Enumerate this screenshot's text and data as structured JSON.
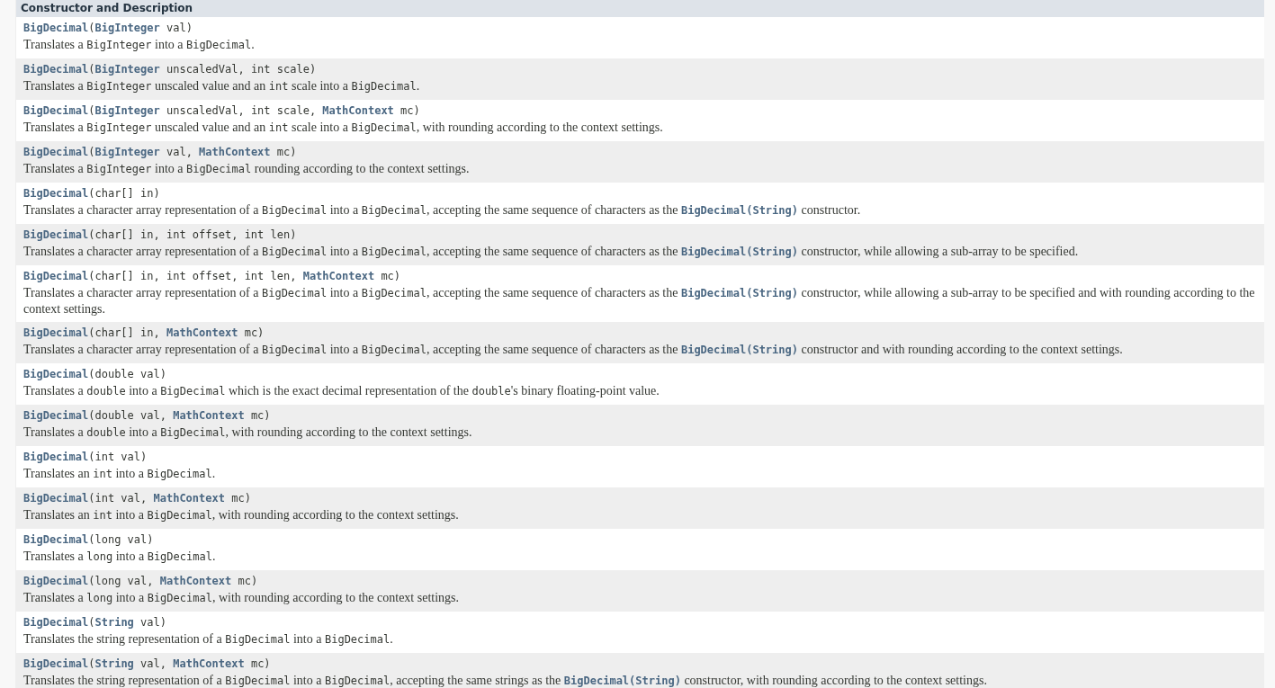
{
  "table": {
    "header": "Constructor and Description",
    "rows": [
      {
        "signature": [
          {
            "kind": "link",
            "text": "BigDecimal"
          },
          {
            "kind": "code",
            "text": "("
          },
          {
            "kind": "link",
            "text": "BigInteger"
          },
          {
            "kind": "code",
            "text": " val)"
          }
        ],
        "description": [
          {
            "kind": "text",
            "text": "Translates a "
          },
          {
            "kind": "code",
            "text": "BigInteger"
          },
          {
            "kind": "text",
            "text": " into a "
          },
          {
            "kind": "code",
            "text": "BigDecimal"
          },
          {
            "kind": "text",
            "text": "."
          }
        ]
      },
      {
        "signature": [
          {
            "kind": "link",
            "text": "BigDecimal"
          },
          {
            "kind": "code",
            "text": "("
          },
          {
            "kind": "link",
            "text": "BigInteger"
          },
          {
            "kind": "code",
            "text": " unscaledVal, int scale)"
          }
        ],
        "description": [
          {
            "kind": "text",
            "text": "Translates a "
          },
          {
            "kind": "code",
            "text": "BigInteger"
          },
          {
            "kind": "text",
            "text": " unscaled value and an "
          },
          {
            "kind": "code",
            "text": "int"
          },
          {
            "kind": "text",
            "text": " scale into a "
          },
          {
            "kind": "code",
            "text": "BigDecimal"
          },
          {
            "kind": "text",
            "text": "."
          }
        ]
      },
      {
        "signature": [
          {
            "kind": "link",
            "text": "BigDecimal"
          },
          {
            "kind": "code",
            "text": "("
          },
          {
            "kind": "link",
            "text": "BigInteger"
          },
          {
            "kind": "code",
            "text": " unscaledVal, int scale, "
          },
          {
            "kind": "link",
            "text": "MathContext"
          },
          {
            "kind": "code",
            "text": " mc)"
          }
        ],
        "description": [
          {
            "kind": "text",
            "text": "Translates a "
          },
          {
            "kind": "code",
            "text": "BigInteger"
          },
          {
            "kind": "text",
            "text": " unscaled value and an "
          },
          {
            "kind": "code",
            "text": "int"
          },
          {
            "kind": "text",
            "text": " scale into a "
          },
          {
            "kind": "code",
            "text": "BigDecimal"
          },
          {
            "kind": "text",
            "text": ", with rounding according to the context settings."
          }
        ]
      },
      {
        "signature": [
          {
            "kind": "link",
            "text": "BigDecimal"
          },
          {
            "kind": "code",
            "text": "("
          },
          {
            "kind": "link",
            "text": "BigInteger"
          },
          {
            "kind": "code",
            "text": " val, "
          },
          {
            "kind": "link",
            "text": "MathContext"
          },
          {
            "kind": "code",
            "text": " mc)"
          }
        ],
        "description": [
          {
            "kind": "text",
            "text": "Translates a "
          },
          {
            "kind": "code",
            "text": "BigInteger"
          },
          {
            "kind": "text",
            "text": " into a "
          },
          {
            "kind": "code",
            "text": "BigDecimal"
          },
          {
            "kind": "text",
            "text": " rounding according to the context settings."
          }
        ]
      },
      {
        "signature": [
          {
            "kind": "link",
            "text": "BigDecimal"
          },
          {
            "kind": "code",
            "text": "(char[] in)"
          }
        ],
        "description": [
          {
            "kind": "text",
            "text": "Translates a character array representation of a "
          },
          {
            "kind": "code",
            "text": "BigDecimal"
          },
          {
            "kind": "text",
            "text": " into a "
          },
          {
            "kind": "code",
            "text": "BigDecimal"
          },
          {
            "kind": "text",
            "text": ", accepting the same sequence of characters as the "
          },
          {
            "kind": "link",
            "text": "BigDecimal(String)"
          },
          {
            "kind": "text",
            "text": " constructor."
          }
        ]
      },
      {
        "signature": [
          {
            "kind": "link",
            "text": "BigDecimal"
          },
          {
            "kind": "code",
            "text": "(char[] in, int offset, int len)"
          }
        ],
        "description": [
          {
            "kind": "text",
            "text": "Translates a character array representation of a "
          },
          {
            "kind": "code",
            "text": "BigDecimal"
          },
          {
            "kind": "text",
            "text": " into a "
          },
          {
            "kind": "code",
            "text": "BigDecimal"
          },
          {
            "kind": "text",
            "text": ", accepting the same sequence of characters as the "
          },
          {
            "kind": "link",
            "text": "BigDecimal(String)"
          },
          {
            "kind": "text",
            "text": " constructor, while allowing a sub-array to be specified."
          }
        ]
      },
      {
        "signature": [
          {
            "kind": "link",
            "text": "BigDecimal"
          },
          {
            "kind": "code",
            "text": "(char[] in, int offset, int len, "
          },
          {
            "kind": "link",
            "text": "MathContext"
          },
          {
            "kind": "code",
            "text": " mc)"
          }
        ],
        "description": [
          {
            "kind": "text",
            "text": "Translates a character array representation of a "
          },
          {
            "kind": "code",
            "text": "BigDecimal"
          },
          {
            "kind": "text",
            "text": " into a "
          },
          {
            "kind": "code",
            "text": "BigDecimal"
          },
          {
            "kind": "text",
            "text": ", accepting the same sequence of characters as the "
          },
          {
            "kind": "link",
            "text": "BigDecimal(String)"
          },
          {
            "kind": "text",
            "text": " constructor, while allowing a sub-array to be specified and with rounding according to the context settings."
          }
        ]
      },
      {
        "signature": [
          {
            "kind": "link",
            "text": "BigDecimal"
          },
          {
            "kind": "code",
            "text": "(char[] in, "
          },
          {
            "kind": "link",
            "text": "MathContext"
          },
          {
            "kind": "code",
            "text": " mc)"
          }
        ],
        "description": [
          {
            "kind": "text",
            "text": "Translates a character array representation of a "
          },
          {
            "kind": "code",
            "text": "BigDecimal"
          },
          {
            "kind": "text",
            "text": " into a "
          },
          {
            "kind": "code",
            "text": "BigDecimal"
          },
          {
            "kind": "text",
            "text": ", accepting the same sequence of characters as the "
          },
          {
            "kind": "link",
            "text": "BigDecimal(String)"
          },
          {
            "kind": "text",
            "text": " constructor and with rounding according to the context settings."
          }
        ]
      },
      {
        "signature": [
          {
            "kind": "link",
            "text": "BigDecimal"
          },
          {
            "kind": "code",
            "text": "(double val)"
          }
        ],
        "description": [
          {
            "kind": "text",
            "text": "Translates a "
          },
          {
            "kind": "code",
            "text": "double"
          },
          {
            "kind": "text",
            "text": " into a "
          },
          {
            "kind": "code",
            "text": "BigDecimal"
          },
          {
            "kind": "text",
            "text": " which is the exact decimal representation of the "
          },
          {
            "kind": "code",
            "text": "double"
          },
          {
            "kind": "text",
            "text": "'s binary floating-point value."
          }
        ]
      },
      {
        "signature": [
          {
            "kind": "link",
            "text": "BigDecimal"
          },
          {
            "kind": "code",
            "text": "(double val, "
          },
          {
            "kind": "link",
            "text": "MathContext"
          },
          {
            "kind": "code",
            "text": " mc)"
          }
        ],
        "description": [
          {
            "kind": "text",
            "text": "Translates a "
          },
          {
            "kind": "code",
            "text": "double"
          },
          {
            "kind": "text",
            "text": " into a "
          },
          {
            "kind": "code",
            "text": "BigDecimal"
          },
          {
            "kind": "text",
            "text": ", with rounding according to the context settings."
          }
        ]
      },
      {
        "signature": [
          {
            "kind": "link",
            "text": "BigDecimal"
          },
          {
            "kind": "code",
            "text": "(int val)"
          }
        ],
        "description": [
          {
            "kind": "text",
            "text": "Translates an "
          },
          {
            "kind": "code",
            "text": "int"
          },
          {
            "kind": "text",
            "text": " into a "
          },
          {
            "kind": "code",
            "text": "BigDecimal"
          },
          {
            "kind": "text",
            "text": "."
          }
        ]
      },
      {
        "signature": [
          {
            "kind": "link",
            "text": "BigDecimal"
          },
          {
            "kind": "code",
            "text": "(int val, "
          },
          {
            "kind": "link",
            "text": "MathContext"
          },
          {
            "kind": "code",
            "text": " mc)"
          }
        ],
        "description": [
          {
            "kind": "text",
            "text": "Translates an "
          },
          {
            "kind": "code",
            "text": "int"
          },
          {
            "kind": "text",
            "text": " into a "
          },
          {
            "kind": "code",
            "text": "BigDecimal"
          },
          {
            "kind": "text",
            "text": ", with rounding according to the context settings."
          }
        ]
      },
      {
        "signature": [
          {
            "kind": "link",
            "text": "BigDecimal"
          },
          {
            "kind": "code",
            "text": "(long val)"
          }
        ],
        "description": [
          {
            "kind": "text",
            "text": "Translates a "
          },
          {
            "kind": "code",
            "text": "long"
          },
          {
            "kind": "text",
            "text": " into a "
          },
          {
            "kind": "code",
            "text": "BigDecimal"
          },
          {
            "kind": "text",
            "text": "."
          }
        ]
      },
      {
        "signature": [
          {
            "kind": "link",
            "text": "BigDecimal"
          },
          {
            "kind": "code",
            "text": "(long val, "
          },
          {
            "kind": "link",
            "text": "MathContext"
          },
          {
            "kind": "code",
            "text": " mc)"
          }
        ],
        "description": [
          {
            "kind": "text",
            "text": "Translates a "
          },
          {
            "kind": "code",
            "text": "long"
          },
          {
            "kind": "text",
            "text": " into a "
          },
          {
            "kind": "code",
            "text": "BigDecimal"
          },
          {
            "kind": "text",
            "text": ", with rounding according to the context settings."
          }
        ]
      },
      {
        "signature": [
          {
            "kind": "link",
            "text": "BigDecimal"
          },
          {
            "kind": "code",
            "text": "("
          },
          {
            "kind": "link",
            "text": "String"
          },
          {
            "kind": "code",
            "text": " val)"
          }
        ],
        "description": [
          {
            "kind": "text",
            "text": "Translates the string representation of a "
          },
          {
            "kind": "code",
            "text": "BigDecimal"
          },
          {
            "kind": "text",
            "text": " into a "
          },
          {
            "kind": "code",
            "text": "BigDecimal"
          },
          {
            "kind": "text",
            "text": "."
          }
        ]
      },
      {
        "signature": [
          {
            "kind": "link",
            "text": "BigDecimal"
          },
          {
            "kind": "code",
            "text": "("
          },
          {
            "kind": "link",
            "text": "String"
          },
          {
            "kind": "code",
            "text": " val, "
          },
          {
            "kind": "link",
            "text": "MathContext"
          },
          {
            "kind": "code",
            "text": " mc)"
          }
        ],
        "description": [
          {
            "kind": "text",
            "text": "Translates the string representation of a "
          },
          {
            "kind": "code",
            "text": "BigDecimal"
          },
          {
            "kind": "text",
            "text": " into a "
          },
          {
            "kind": "code",
            "text": "BigDecimal"
          },
          {
            "kind": "text",
            "text": ", accepting the same strings as the "
          },
          {
            "kind": "link",
            "text": "BigDecimal(String)"
          },
          {
            "kind": "text",
            "text": " constructor, with rounding according to the context settings."
          }
        ]
      }
    ]
  }
}
